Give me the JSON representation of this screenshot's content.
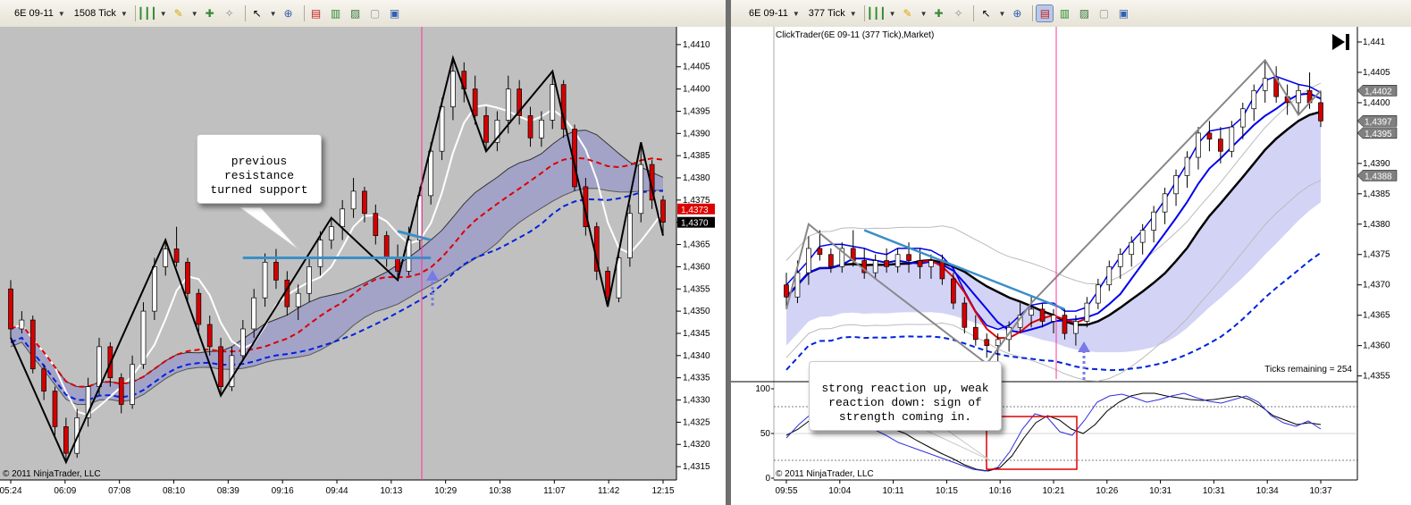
{
  "left_toolbar": {
    "instrument": "6E 09-11",
    "period": "1508 Tick"
  },
  "right_toolbar": {
    "instrument": "6E 09-11",
    "period": "377 Tick"
  },
  "colors": {
    "up_candle": "#ffffff",
    "down_candle": "#d40000",
    "zigzag": "#000000",
    "cloud_fill": "#9b9bc8",
    "cloud_red": "#c9a0a0",
    "ma_blue_dash": "#0022dd",
    "ma_red_dash": "#dd0000",
    "trendline": "#3a8fc8",
    "signal_line": "#ff3399",
    "arrow": "#7a7ae6"
  },
  "chart_data": [
    {
      "type": "candlestick",
      "panel": "left",
      "copyright": "© 2011 NinjaTrader, LLC",
      "ylim": [
        1.4312,
        1.4414
      ],
      "y_ticks": [
        "1,4410",
        "1,4405",
        "1,4400",
        "1,4395",
        "1,4390",
        "1,4385",
        "1,4380",
        "1,4375",
        "1,4370",
        "1,4365",
        "1,4360",
        "1,4355",
        "1,4350",
        "1,4345",
        "1,4340",
        "1,4335",
        "1,4330",
        "1,4325",
        "1,4320",
        "1,4315"
      ],
      "y_tick_values": [
        1.441,
        1.4405,
        1.44,
        1.4395,
        1.439,
        1.4385,
        1.438,
        1.4375,
        1.437,
        1.4365,
        1.436,
        1.4355,
        1.435,
        1.4345,
        1.434,
        1.4335,
        1.433,
        1.4325,
        1.432,
        1.4315
      ],
      "x_ticks": [
        "05:24",
        "06:09",
        "07:08",
        "08:10",
        "08:39",
        "09:16",
        "09:44",
        "10:13",
        "10:29",
        "10:38",
        "11:07",
        "11:42",
        "12:15"
      ],
      "price_labels": [
        {
          "text": "1,4373",
          "value": 1.4373,
          "color": "#dd0000"
        },
        {
          "text": "1,4370",
          "value": 1.437,
          "color": "#000000"
        }
      ],
      "candles": [
        [
          1.4355,
          1.4357,
          1.4344,
          1.4346
        ],
        [
          1.4346,
          1.435,
          1.4345,
          1.4348
        ],
        [
          1.4348,
          1.4349,
          1.4336,
          1.4337
        ],
        [
          1.4337,
          1.4338,
          1.433,
          1.4332
        ],
        [
          1.4332,
          1.4333,
          1.4322,
          1.4324
        ],
        [
          1.4324,
          1.4326,
          1.4316,
          1.4318
        ],
        [
          1.4318,
          1.4328,
          1.4317,
          1.4326
        ],
        [
          1.4326,
          1.4335,
          1.4324,
          1.4333
        ],
        [
          1.4333,
          1.4344,
          1.4331,
          1.4342
        ],
        [
          1.4342,
          1.4343,
          1.4333,
          1.4335
        ],
        [
          1.4335,
          1.4336,
          1.4327,
          1.4329
        ],
        [
          1.4329,
          1.434,
          1.4328,
          1.4338
        ],
        [
          1.4338,
          1.4352,
          1.4337,
          1.435
        ],
        [
          1.435,
          1.4362,
          1.4348,
          1.436
        ],
        [
          1.436,
          1.4366,
          1.4358,
          1.4364
        ],
        [
          1.4364,
          1.4369,
          1.436,
          1.4361
        ],
        [
          1.4361,
          1.4362,
          1.4352,
          1.4354
        ],
        [
          1.4354,
          1.4355,
          1.4345,
          1.4347
        ],
        [
          1.4347,
          1.4349,
          1.434,
          1.4342
        ],
        [
          1.4342,
          1.4344,
          1.4331,
          1.4333
        ],
        [
          1.4333,
          1.4342,
          1.4332,
          1.434
        ],
        [
          1.434,
          1.4348,
          1.4339,
          1.4346
        ],
        [
          1.4346,
          1.4355,
          1.4344,
          1.4353
        ],
        [
          1.4353,
          1.4363,
          1.4351,
          1.4361
        ],
        [
          1.4361,
          1.4364,
          1.4355,
          1.4357
        ],
        [
          1.4357,
          1.4359,
          1.4349,
          1.4351
        ],
        [
          1.4351,
          1.4356,
          1.4348,
          1.4354
        ],
        [
          1.4354,
          1.4362,
          1.4352,
          1.436
        ],
        [
          1.436,
          1.4368,
          1.4358,
          1.4366
        ],
        [
          1.4366,
          1.4371,
          1.4364,
          1.4369
        ],
        [
          1.4369,
          1.4375,
          1.4366,
          1.4373
        ],
        [
          1.4373,
          1.438,
          1.4371,
          1.4377
        ],
        [
          1.4377,
          1.4378,
          1.437,
          1.4372
        ],
        [
          1.4372,
          1.4374,
          1.4365,
          1.4367
        ],
        [
          1.4367,
          1.4368,
          1.436,
          1.4362
        ],
        [
          1.4362,
          1.4365,
          1.4357,
          1.4359
        ],
        [
          1.4359,
          1.4369,
          1.4358,
          1.4366
        ],
        [
          1.4366,
          1.4378,
          1.4364,
          1.4376
        ],
        [
          1.4376,
          1.4388,
          1.4374,
          1.4386
        ],
        [
          1.4386,
          1.4398,
          1.4384,
          1.4396
        ],
        [
          1.4396,
          1.4407,
          1.4393,
          1.4404
        ],
        [
          1.4404,
          1.4406,
          1.4397,
          1.44
        ],
        [
          1.44,
          1.4403,
          1.4392,
          1.4394
        ],
        [
          1.4394,
          1.4396,
          1.4386,
          1.4388
        ],
        [
          1.4388,
          1.4395,
          1.4386,
          1.4393
        ],
        [
          1.4393,
          1.4403,
          1.439,
          1.44
        ],
        [
          1.44,
          1.4402,
          1.4392,
          1.4394
        ],
        [
          1.4394,
          1.4396,
          1.4387,
          1.4389
        ],
        [
          1.4389,
          1.4395,
          1.4387,
          1.4393
        ],
        [
          1.4393,
          1.4404,
          1.4391,
          1.4401
        ],
        [
          1.4401,
          1.4402,
          1.4389,
          1.4391
        ],
        [
          1.4391,
          1.4392,
          1.4377,
          1.4378
        ],
        [
          1.4378,
          1.438,
          1.4367,
          1.4369
        ],
        [
          1.4369,
          1.437,
          1.4357,
          1.4359
        ],
        [
          1.4359,
          1.436,
          1.4351,
          1.4353
        ],
        [
          1.4353,
          1.4364,
          1.4352,
          1.4362
        ],
        [
          1.4362,
          1.4374,
          1.436,
          1.4372
        ],
        [
          1.4372,
          1.4388,
          1.437,
          1.4383
        ],
        [
          1.4383,
          1.4384,
          1.4373,
          1.4375
        ],
        [
          1.4375,
          1.4376,
          1.4367,
          1.437
        ]
      ],
      "annotations": [
        {
          "text": "previous\nresistance\nturned support"
        }
      ]
    },
    {
      "type": "candlestick",
      "panel": "right",
      "title": "ClickTrader(6E 09-11 (377 Tick),Market)",
      "copyright": "© 2011 NinjaTrader, LLC",
      "ticks_remaining": "Ticks remaining = 254",
      "ylim": [
        1.43545,
        1.44125
      ],
      "y_ticks": [
        "1,441",
        "1,4405",
        "1,4400",
        "1,4395",
        "1,4390",
        "1,4385",
        "1,4380",
        "1,4375",
        "1,4370",
        "1,4365",
        "1,4360",
        "1,4355"
      ],
      "y_tick_values": [
        1.441,
        1.4405,
        1.44,
        1.4395,
        1.439,
        1.4385,
        1.438,
        1.4375,
        1.437,
        1.4365,
        1.436,
        1.4355
      ],
      "x_ticks": [
        "09:55",
        "10:04",
        "10:11",
        "10:15",
        "10:16",
        "10:21",
        "10:26",
        "10:31",
        "10:31",
        "10:34",
        "10:37"
      ],
      "price_labels": [
        {
          "text": "1,4402",
          "value": 1.4402
        },
        {
          "text": "1,4397",
          "value": 1.4397
        },
        {
          "text": "1,4395",
          "value": 1.4395
        },
        {
          "text": "1,4388",
          "value": 1.4388
        }
      ],
      "candles": [
        [
          1.437,
          1.4372,
          1.4366,
          1.4368
        ],
        [
          1.4368,
          1.4374,
          1.4367,
          1.4372
        ],
        [
          1.4372,
          1.4378,
          1.437,
          1.4376
        ],
        [
          1.4376,
          1.4379,
          1.4374,
          1.4375
        ],
        [
          1.4375,
          1.4376,
          1.4372,
          1.4373
        ],
        [
          1.4373,
          1.4377,
          1.4372,
          1.4376
        ],
        [
          1.4376,
          1.4379,
          1.4373,
          1.4374
        ],
        [
          1.4374,
          1.4376,
          1.4371,
          1.4372
        ],
        [
          1.4372,
          1.4375,
          1.4371,
          1.4374
        ],
        [
          1.4374,
          1.4376,
          1.4372,
          1.4373
        ],
        [
          1.4373,
          1.4376,
          1.4372,
          1.4375
        ],
        [
          1.4375,
          1.4377,
          1.4372,
          1.4374
        ],
        [
          1.4374,
          1.4376,
          1.4371,
          1.4373
        ],
        [
          1.4373,
          1.4375,
          1.4371,
          1.4374
        ],
        [
          1.4374,
          1.4375,
          1.437,
          1.4371
        ],
        [
          1.4371,
          1.4372,
          1.4366,
          1.4367
        ],
        [
          1.4367,
          1.4368,
          1.4362,
          1.4363
        ],
        [
          1.4363,
          1.4365,
          1.436,
          1.4361
        ],
        [
          1.4361,
          1.4362,
          1.4358,
          1.436
        ],
        [
          1.436,
          1.4362,
          1.4357,
          1.4361
        ],
        [
          1.4361,
          1.4364,
          1.4359,
          1.4363
        ],
        [
          1.4363,
          1.4367,
          1.4362,
          1.4365
        ],
        [
          1.4365,
          1.4368,
          1.4363,
          1.4366
        ],
        [
          1.4366,
          1.4367,
          1.4363,
          1.4364
        ],
        [
          1.4364,
          1.4366,
          1.4362,
          1.4365
        ],
        [
          1.4365,
          1.4366,
          1.4361,
          1.4362
        ],
        [
          1.4362,
          1.4365,
          1.436,
          1.4364
        ],
        [
          1.4364,
          1.4368,
          1.4363,
          1.4367
        ],
        [
          1.4367,
          1.4371,
          1.4366,
          1.437
        ],
        [
          1.437,
          1.4374,
          1.4369,
          1.4373
        ],
        [
          1.4373,
          1.4376,
          1.4371,
          1.4375
        ],
        [
          1.4375,
          1.4378,
          1.4373,
          1.4377
        ],
        [
          1.4377,
          1.438,
          1.4375,
          1.4379
        ],
        [
          1.4379,
          1.4383,
          1.4377,
          1.4382
        ],
        [
          1.4382,
          1.4386,
          1.438,
          1.4385
        ],
        [
          1.4385,
          1.4389,
          1.4383,
          1.4388
        ],
        [
          1.4388,
          1.4392,
          1.4386,
          1.4391
        ],
        [
          1.4391,
          1.4396,
          1.4389,
          1.4395
        ],
        [
          1.4395,
          1.4397,
          1.4392,
          1.4394
        ],
        [
          1.4394,
          1.4396,
          1.439,
          1.4392
        ],
        [
          1.4392,
          1.4397,
          1.4391,
          1.4396
        ],
        [
          1.4396,
          1.44,
          1.4394,
          1.4399
        ],
        [
          1.4399,
          1.4403,
          1.4397,
          1.4402
        ],
        [
          1.4402,
          1.4407,
          1.44,
          1.4404
        ],
        [
          1.4404,
          1.4406,
          1.44,
          1.4401
        ],
        [
          1.4401,
          1.4403,
          1.4398,
          1.44
        ],
        [
          1.44,
          1.4403,
          1.4398,
          1.4402
        ],
        [
          1.4402,
          1.4405,
          1.4399,
          1.44
        ],
        [
          1.44,
          1.4402,
          1.4396,
          1.4397
        ]
      ],
      "oscillator": {
        "ylim": [
          0,
          100
        ],
        "y_ticks": [
          "100",
          "50",
          "0"
        ],
        "y_tick_values": [
          100,
          50,
          0
        ],
        "levels": [
          80,
          20
        ],
        "series_black": [
          48,
          55,
          65,
          72,
          78,
          80,
          75,
          68,
          60,
          55,
          50,
          42,
          35,
          28,
          22,
          15,
          10,
          8,
          12,
          25,
          45,
          62,
          70,
          65,
          55,
          50,
          60,
          75,
          85,
          92,
          95,
          95,
          92,
          90,
          88,
          87,
          88,
          90,
          92,
          88,
          80,
          70,
          65,
          60,
          62,
          60
        ],
        "series_blue": [
          45,
          60,
          72,
          80,
          82,
          70,
          62,
          55,
          48,
          40,
          35,
          30,
          25,
          20,
          15,
          10,
          8,
          12,
          30,
          55,
          72,
          68,
          52,
          48,
          65,
          85,
          92,
          94,
          90,
          85,
          88,
          92,
          95,
          90,
          86,
          84,
          88,
          92,
          85,
          70,
          62,
          58,
          64,
          55
        ]
      },
      "annotations": [
        {
          "text": "strong reaction up, weak\nreaction down: sign of\nstrength coming in."
        }
      ]
    }
  ]
}
